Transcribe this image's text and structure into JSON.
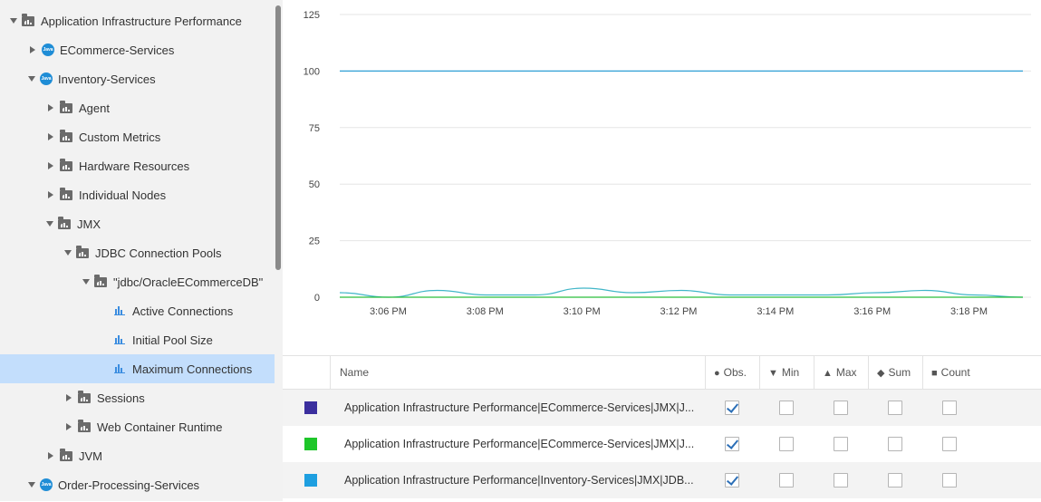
{
  "tree": {
    "items": [
      {
        "label": "Application Infrastructure Performance",
        "depth": 0,
        "expander": "down",
        "icon": "folder-icon",
        "selected": false
      },
      {
        "label": "ECommerce-Services",
        "depth": 1,
        "expander": "right",
        "icon": "java-icon",
        "selected": false
      },
      {
        "label": "Inventory-Services",
        "depth": 1,
        "expander": "down",
        "icon": "java-icon",
        "selected": false
      },
      {
        "label": "Agent",
        "depth": 2,
        "expander": "right",
        "icon": "folder-icon",
        "selected": false
      },
      {
        "label": "Custom Metrics",
        "depth": 2,
        "expander": "right",
        "icon": "folder-icon",
        "selected": false
      },
      {
        "label": "Hardware Resources",
        "depth": 2,
        "expander": "right",
        "icon": "folder-icon",
        "selected": false
      },
      {
        "label": "Individual Nodes",
        "depth": 2,
        "expander": "right",
        "icon": "folder-icon",
        "selected": false
      },
      {
        "label": "JMX",
        "depth": 2,
        "expander": "down",
        "icon": "folder-icon",
        "selected": false
      },
      {
        "label": "JDBC Connection Pools",
        "depth": 3,
        "expander": "down",
        "icon": "folder-icon",
        "selected": false
      },
      {
        "label": "\"jdbc/OracleECommerceDB\"",
        "depth": 4,
        "expander": "down",
        "icon": "folder-icon",
        "selected": false
      },
      {
        "label": "Active Connections",
        "depth": 5,
        "expander": "none",
        "icon": "metric-icon",
        "selected": false
      },
      {
        "label": "Initial Pool Size",
        "depth": 5,
        "expander": "none",
        "icon": "metric-icon",
        "selected": false
      },
      {
        "label": "Maximum Connections",
        "depth": 5,
        "expander": "none",
        "icon": "metric-icon",
        "selected": true
      },
      {
        "label": "Sessions",
        "depth": 3,
        "expander": "right",
        "icon": "folder-icon",
        "selected": false
      },
      {
        "label": "Web Container Runtime",
        "depth": 3,
        "expander": "right",
        "icon": "folder-icon",
        "selected": false
      },
      {
        "label": "JVM",
        "depth": 2,
        "expander": "right",
        "icon": "folder-icon",
        "selected": false
      },
      {
        "label": "Order-Processing-Services",
        "depth": 1,
        "expander": "down",
        "icon": "java-icon",
        "selected": false
      }
    ],
    "java_icon_text": "Java"
  },
  "chart_data": {
    "type": "line",
    "ylim": [
      0,
      125
    ],
    "yticks": [
      0,
      25,
      50,
      75,
      100,
      125
    ],
    "xlim": [
      0,
      14.3
    ],
    "xticks": [
      {
        "value": 1,
        "label": "3:06 PM"
      },
      {
        "value": 3,
        "label": "3:08 PM"
      },
      {
        "value": 5,
        "label": "3:10 PM"
      },
      {
        "value": 7,
        "label": "3:12 PM"
      },
      {
        "value": 9,
        "label": "3:14 PM"
      },
      {
        "value": 11,
        "label": "3:16 PM"
      },
      {
        "value": 13,
        "label": "3:18 PM"
      }
    ],
    "grid": true,
    "series": [
      {
        "color": "#2f9fd6",
        "x": [
          0,
          14
        ],
        "y": [
          100,
          100
        ]
      },
      {
        "color": "#41b6c8",
        "x": [
          0,
          1,
          2,
          3,
          4,
          5,
          6,
          7,
          8,
          9,
          10,
          11,
          12,
          13,
          14
        ],
        "y": [
          2,
          0,
          3,
          1,
          1,
          4,
          2,
          3,
          1,
          1,
          1,
          2,
          3,
          1,
          0
        ]
      },
      {
        "color": "#2bbf3a",
        "x": [
          0,
          14
        ],
        "y": [
          0,
          0
        ]
      }
    ]
  },
  "table": {
    "columns": [
      {
        "key": "name",
        "label": "Name",
        "symbol": ""
      },
      {
        "key": "obs",
        "label": "Obs.",
        "symbol": "●"
      },
      {
        "key": "min",
        "label": "Min",
        "symbol": "▼"
      },
      {
        "key": "max",
        "label": "Max",
        "symbol": "▲"
      },
      {
        "key": "sum",
        "label": "Sum",
        "symbol": "◆"
      },
      {
        "key": "count",
        "label": "Count",
        "symbol": "■"
      }
    ],
    "rows": [
      {
        "color": "#3b2f9e",
        "name": "Application Infrastructure Performance|ECommerce-Services|JMX|J...",
        "obs": true,
        "min": false,
        "max": false,
        "sum": false,
        "count": false
      },
      {
        "color": "#1ec62a",
        "name": "Application Infrastructure Performance|ECommerce-Services|JMX|J...",
        "obs": true,
        "min": false,
        "max": false,
        "sum": false,
        "count": false
      },
      {
        "color": "#1e9fe0",
        "name": "Application Infrastructure Performance|Inventory-Services|JMX|JDB...",
        "obs": true,
        "min": false,
        "max": false,
        "sum": false,
        "count": false
      }
    ]
  }
}
